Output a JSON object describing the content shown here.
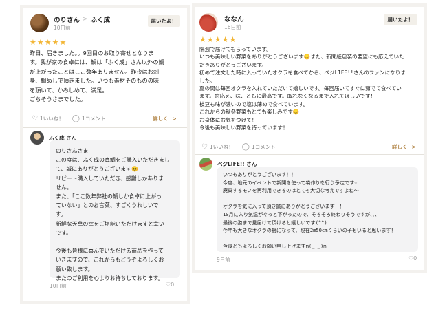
{
  "left_card": {
    "author": "のりさん",
    "shop": "ふく成",
    "posted": "10日前",
    "badge": "届いたよ！",
    "stars": "★★★★★",
    "body": "昨日、届きました。。9回目のお取り寄せとなりま\nす。我が家の食卓には、鯛は「ふく成」さん以外の鯛\nが上がったことはここ数年ありません。昨夜はお刺\n身、鯛めしで頂きました。いつも素材そのものの味\nを頂いて、かみしめて、満足。\nごちそうさまでした。",
    "likes": "1いいね！",
    "comments": "1コメント",
    "detail": "詳しく",
    "reply": {
      "name": "ふく成 さん",
      "text": "のりさんさま\nこの度は、ふく成の真鯛をご購入いただきまし\nて、誠にありがとうございます😊\nリピート購入していただき、感謝しかありま\nせん。\nまた、「ここ数年弊社の鯛しか食卓に上がっ\nていない」とのお言葉、すごくうれしいで\nす。\n新鮮な天草の幸をご堪能いただけますと幸い\nです。\n\n今後も皆様に喜んでいただける商品を作って\nいきますので、これからもどうぞよろしくお\n願い致します。\nまたのご利用を心よりお待ちしております。",
      "date": "10日前",
      "likes": "♡0"
    }
  },
  "right_card": {
    "author": "ななん",
    "posted": "16日前",
    "badge": "届いたよ！",
    "stars": "★★★★★",
    "body": "隔週で届けてもらっています。\nいつも美味しい野菜をありがとうございます😊また、新聞紙包装の要望にも応えていた\nだきありがとうございます。\n初めて注文した時に入っていたオクラを食べてから、ベジLIFE!!さんのファンになりま\nした。\n夏の間は毎回オクラを入れていただいて嬉しいです。毎回届いてすぐに茹でて食べてい\nます。歯応え、味、ともに最高です。取れなくなるまで入れてほしいです！\n枝豆も味が濃いので塩は薄めで食べています。\nこれからの秋冬野菜もとても楽しみです😊\nお身体にお気をつけて！\n今後も美味しい野菜を待っています！",
    "likes": "1いいね！",
    "comments": "1コメント",
    "detail": "詳しく",
    "reply": {
      "name": "ベジLIFE!! さん",
      "text": "いつもありがとうございます！！\n今度、地元のイベントで新聞を使って袋作りを行う予定です☆\n廃棄するモノを再利用できるのはとても大切な考えですよね〜\n\nオクラを気に入って頂き誠にありがとうございます！！\n10月に入り気温がぐっと下がったので、そろそろ終わりそうですが、、、\n最後の姿まで見届けて頂けると嬉しいです(^^)\n今年も大きなオクラの樹になって、現在2m50cmくらいの子もいると思います！\n\n今後ともよろしくお願い申し上げますm(_ _)m",
      "date": "9日前",
      "likes": "♡0"
    }
  }
}
